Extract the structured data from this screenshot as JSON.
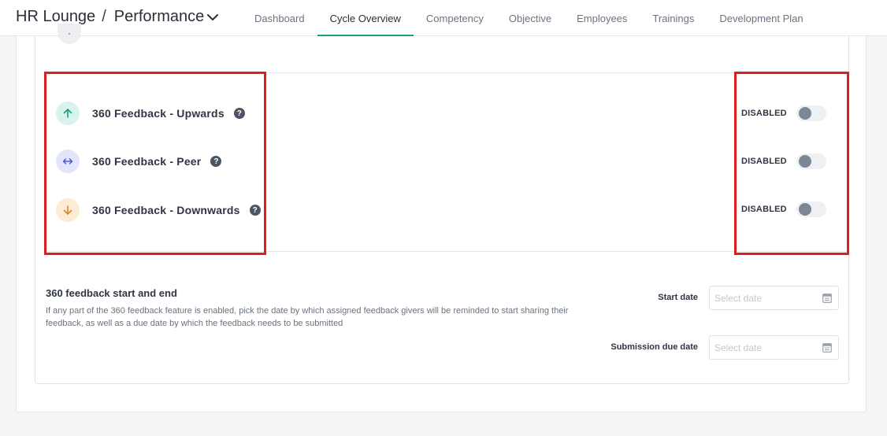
{
  "header": {
    "brand": "HR Lounge",
    "separator": "/",
    "module": "Performance",
    "tabs": [
      {
        "label": "Dashboard",
        "active": false
      },
      {
        "label": "Cycle Overview",
        "active": true
      },
      {
        "label": "Competency",
        "active": false
      },
      {
        "label": "Objective",
        "active": false
      },
      {
        "label": "Employees",
        "active": false
      },
      {
        "label": "Trainings",
        "active": false
      },
      {
        "label": "Development Plan",
        "active": false
      }
    ],
    "accent_color": "#1a9c7f"
  },
  "feedback": {
    "items": [
      {
        "label": "360 Feedback - Upwards",
        "icon": "arrow-up-icon",
        "icon_color": "#1a9c7f",
        "icon_bg": "#d8f3ec",
        "status": "DISABLED",
        "enabled": false
      },
      {
        "label": "360 Feedback - Peer",
        "icon": "arrow-left-right-icon",
        "icon_color": "#4f5bd5",
        "icon_bg": "#e3e5fa",
        "status": "DISABLED",
        "enabled": false
      },
      {
        "label": "360 Feedback - Downwards",
        "icon": "arrow-down-icon",
        "icon_color": "#d9892b",
        "icon_bg": "#fdecd3",
        "status": "DISABLED",
        "enabled": false
      }
    ],
    "help_glyph": "?"
  },
  "dates": {
    "title": "360 feedback start and end",
    "description": "If any part of the 360 feedback feature is enabled, pick the date by which assigned feedback givers will be reminded to start sharing their feedback, as well as a due date by which the feedback needs to be submitted",
    "start_label": "Start date",
    "start_placeholder": "Select date",
    "start_value": "",
    "due_label": "Submission due date",
    "due_placeholder": "Select date",
    "due_value": ""
  },
  "highlight_color": "#e11d1d"
}
